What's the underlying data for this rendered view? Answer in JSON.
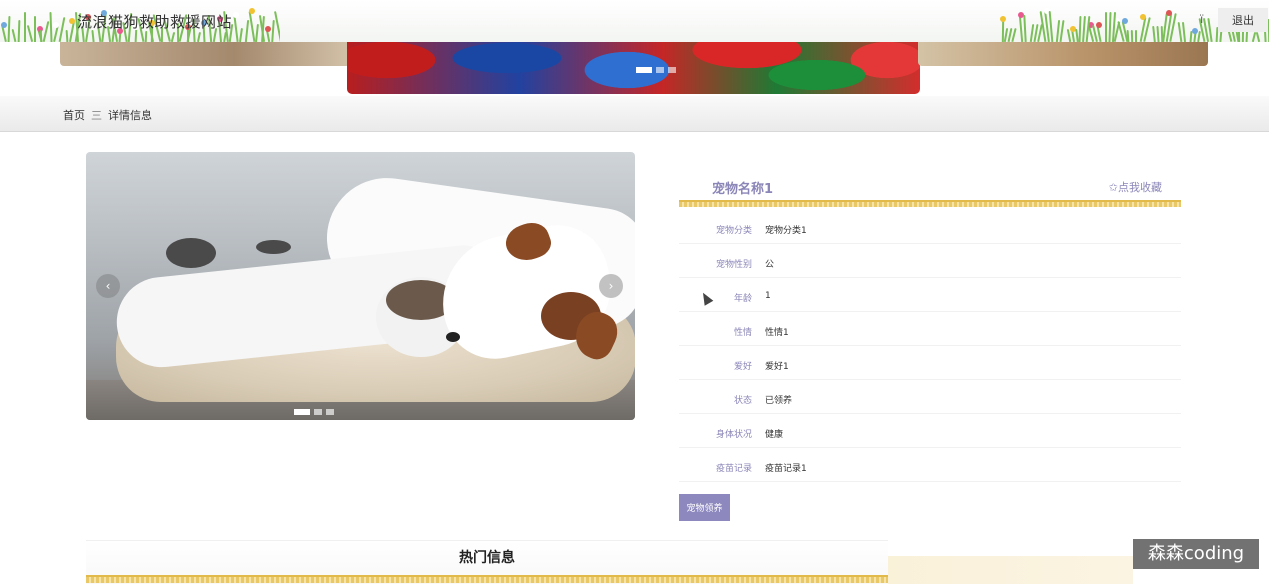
{
  "header": {
    "site_title": "流浪猫狗救助救援网站",
    "user_glyph": "ï",
    "logout_label": "退出"
  },
  "breadcrumb": {
    "home": "首页",
    "separator": "三",
    "current": "详情信息"
  },
  "gallery": {
    "prev_glyph": "‹",
    "next_glyph": "›",
    "slide_count": 3,
    "active_slide": 1
  },
  "banner": {
    "slide_count": 3,
    "active_slide": 1
  },
  "detail": {
    "pet_name": "宠物名称1",
    "favorite_label": "✩点我收藏",
    "fields": [
      {
        "label": "宠物分类",
        "value": "宠物分类1"
      },
      {
        "label": "宠物性别",
        "value": "公"
      },
      {
        "label": "年龄",
        "value": "1"
      },
      {
        "label": "性情",
        "value": "性情1"
      },
      {
        "label": "爱好",
        "value": "爱好1"
      },
      {
        "label": "状态",
        "value": "已领养"
      },
      {
        "label": "身体状况",
        "value": "健康"
      },
      {
        "label": "疫苗记录",
        "value": "疫苗记录1"
      }
    ],
    "adopt_label": "宠物领养"
  },
  "hot": {
    "title": "热门信息"
  },
  "watermark": "森森coding",
  "colors": {
    "accent": "#8d88bd",
    "fringe": "#e9c868"
  }
}
